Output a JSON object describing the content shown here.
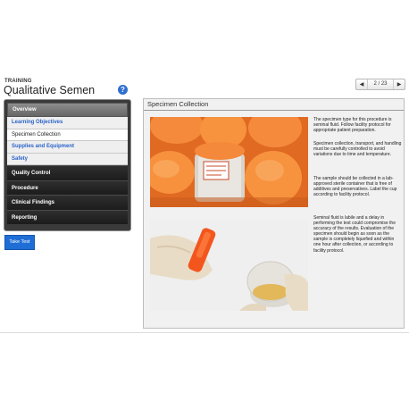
{
  "header": {
    "section_label": "TRAINING",
    "module_title": "Qualitative Semen",
    "help_icon_glyph": "?"
  },
  "pager": {
    "prev_glyph": "◀",
    "count": "2 / 23",
    "next_glyph": "▶"
  },
  "nav": {
    "overview": "Overview",
    "sub_items": [
      {
        "label": "Learning Objectives",
        "active": false
      },
      {
        "label": "Specimen Collection",
        "active": true
      },
      {
        "label": "Supplies and Equipment",
        "active": false
      },
      {
        "label": "Safety",
        "active": false
      }
    ],
    "main_items": [
      "Quality Control",
      "Procedure",
      "Clinical Findings",
      "Reporting"
    ]
  },
  "take_test_label": "Take Test",
  "content": {
    "title": "Specimen Collection",
    "paragraphs": [
      "The specimen type for this procedure is seminal fluid. Follow facility protocol for appropriate patient preparation.",
      "Specimen collection, transport, and handling must be carefully controlled to avoid variations due to time and temperature.",
      "The sample should be collected in a lab-approved sterile container that is free of additives and preservatives. Label the cup according to facility protocol.",
      "Seminal fluid is labile and a delay in performing the test could compromise the accuracy of the results. Evaluation of the specimen should begin as soon as the sample is completely liquefied and within one hour after collection, or according to facility protocol."
    ]
  },
  "colors": {
    "accent_blue": "#2f6fd0",
    "cap_orange": "#f07a2c",
    "nav_dark": "#1c1c1c"
  }
}
